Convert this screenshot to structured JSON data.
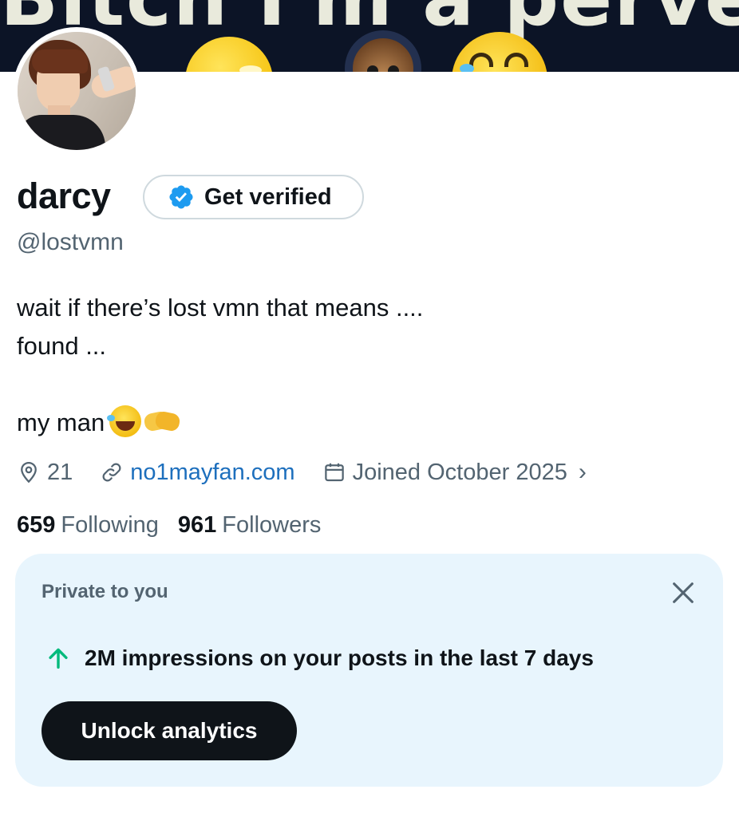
{
  "banner": {
    "text": "Bitch I'm a pervert"
  },
  "profile": {
    "name": "darcy",
    "verify_button": "Get verified",
    "handle": "@lostvmn",
    "bio": {
      "line1": "wait if there’s lost vmn that means ....",
      "line2": "found ...",
      "line3": "my man"
    },
    "location": "21",
    "website": "no1mayfan.com",
    "joined": "Joined October 2025",
    "following_count": "659",
    "following_label": "Following",
    "followers_count": "961",
    "followers_label": "Followers"
  },
  "private_card": {
    "title": "Private to you",
    "stat": "2M impressions on your posts in the last 7 days",
    "button": "Unlock analytics"
  },
  "icons": {
    "verified": "verified-badge-icon",
    "location": "location-pin-icon",
    "link": "link-icon",
    "calendar": "calendar-icon",
    "chevron": "chevron-right-icon",
    "close": "close-icon",
    "trend": "arrow-up-icon"
  },
  "colors": {
    "accent_blue": "#1d9bf0",
    "link": "#1d6fbd",
    "trend_green": "#00ba7c",
    "card_bg": "#e8f5fd",
    "button_dark": "#0f1419"
  }
}
